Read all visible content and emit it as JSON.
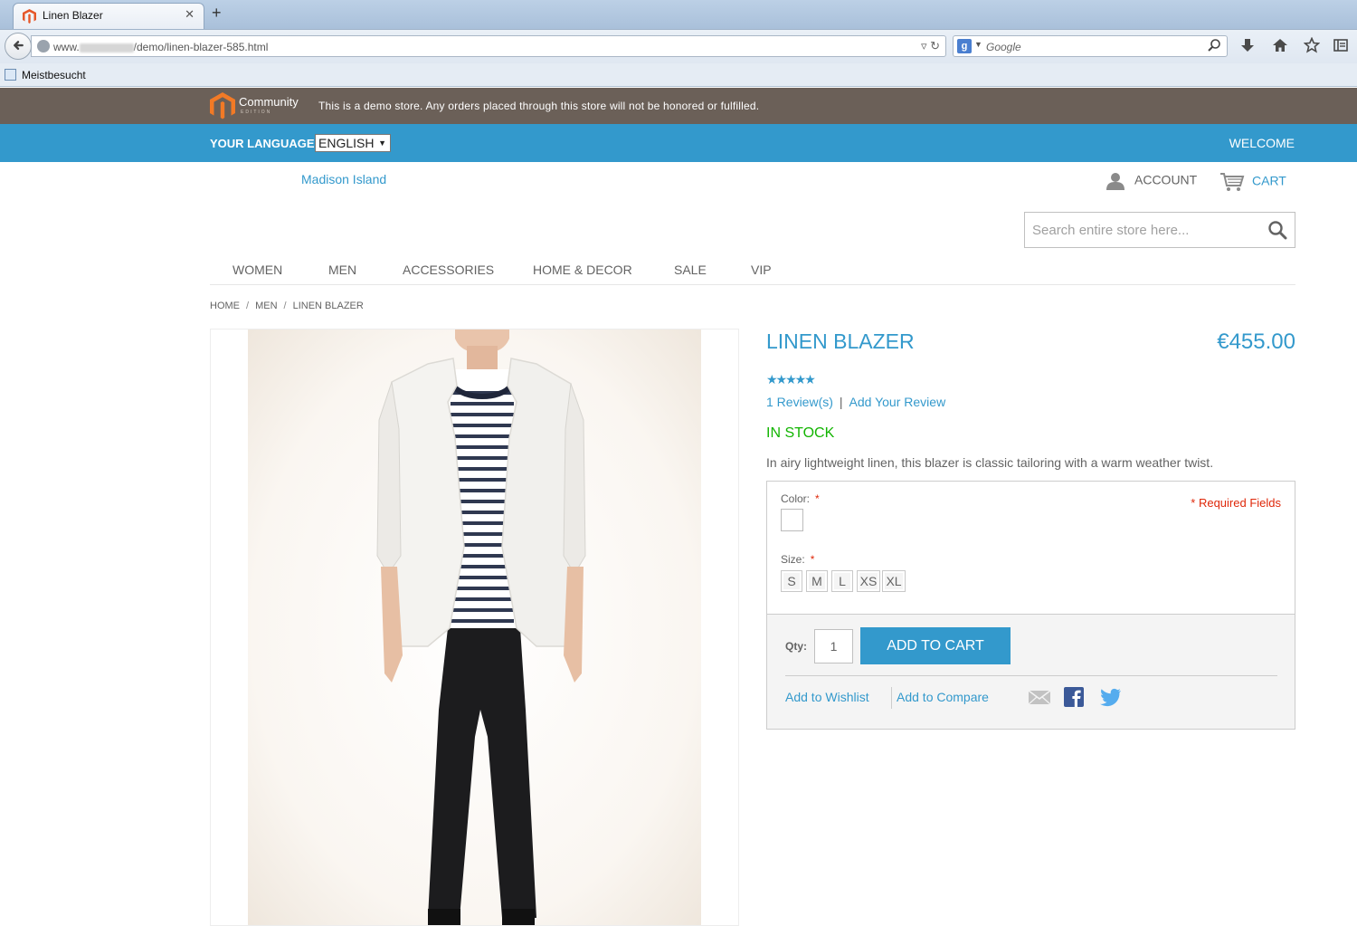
{
  "browser": {
    "tab_title": "Linen Blazer",
    "tab_close": "✕",
    "new_tab": "+",
    "url_prefix": "www.",
    "url_path": "/demo/linen-blazer-585.html",
    "search_engine_letter": "g",
    "search_placeholder": "Google",
    "bookmark_label": "Meistbesucht"
  },
  "store": {
    "edition_word": "Community",
    "edition_sub": "EDITION",
    "demo_notice": "This is a demo store. Any orders placed through this store will not be honored or fulfilled.",
    "language_label": "YOUR LANGUAGE:",
    "language_value": "ENGLISH",
    "welcome": "WELCOME",
    "store_name": "Madison Island",
    "account_label": "ACCOUNT",
    "cart_label": "CART",
    "search_placeholder": "Search entire store here...",
    "nav": [
      "WOMEN",
      "MEN",
      "ACCESSORIES",
      "HOME & DECOR",
      "SALE",
      "VIP"
    ],
    "breadcrumb": [
      "HOME",
      "MEN",
      "LINEN BLAZER"
    ],
    "breadcrumb_sep": "/"
  },
  "product": {
    "name": "LINEN BLAZER",
    "price": "€455.00",
    "rating_stars": "★★★★★",
    "rating": 5,
    "reviews_link": "1 Review(s)",
    "reviews_sep": "|",
    "add_review_link": "Add Your Review",
    "stock": "IN STOCK",
    "description": "In airy lightweight linen, this blazer is classic tailoring with a warm weather twist.",
    "color_label": "Color:",
    "size_label": "Size:",
    "required_mark": "*",
    "required_fields": "* Required Fields",
    "sizes": [
      "S",
      "M",
      "L",
      "XS",
      "XL"
    ],
    "qty_label": "Qty:",
    "qty_value": "1",
    "add_to_cart": "ADD TO CART",
    "wishlist_link": "Add to Wishlist",
    "compare_link": "Add to Compare"
  },
  "colors": {
    "accent": "#3399cc",
    "demo_bar": "#6b6058",
    "in_stock": "#11b400",
    "required": "#df280a",
    "text": "#636363"
  }
}
